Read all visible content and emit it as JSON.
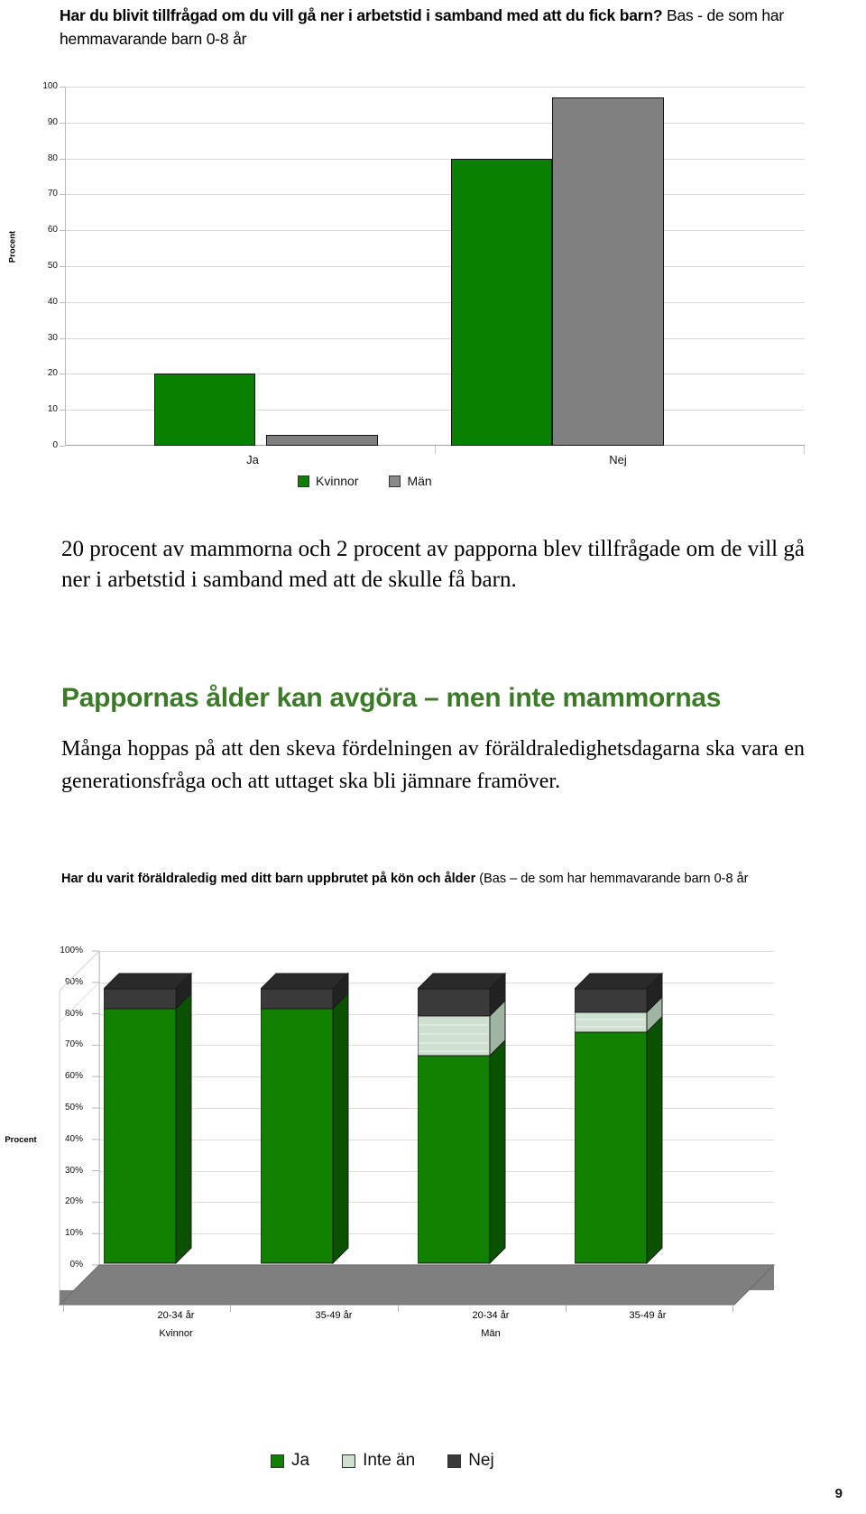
{
  "page_number": "9",
  "chart1": {
    "title_bold": "Har du blivit tillfrågad om du vill gå ner i arbetstid i samband med att du fick barn?",
    "title_light": "Bas - de som har hemmavarande barn 0-8 år",
    "axis_title": "Procent",
    "legend": [
      {
        "label": "Kvinnor",
        "color": "#0a8000"
      },
      {
        "label": "Män",
        "color": "#8a8a8a"
      }
    ],
    "categories": [
      "Ja",
      "Nej"
    ],
    "yticks": [
      "100",
      "90",
      "80",
      "70",
      "60",
      "50",
      "40",
      "30",
      "20",
      "10",
      "0"
    ]
  },
  "lead_paragraph": "20 procent av mammorna och 2 procent av papporna blev tillfrågade om de vill gå ner i arbetstid i samband med att de skulle få barn.",
  "green_heading": "Pappornas ålder kan avgöra – men inte mammornas",
  "paragraph_2": "Många hoppas på att den skeva fördelningen av föräldraledighetsdagarna ska vara en generationsfråga och att uttaget ska bli jämnare framöver.",
  "chart2": {
    "title_bold": "Har du varit föräldraledig med ditt barn uppbrutet på kön och ålder",
    "title_light": "(Bas – de som har hemmavarande barn 0-8 år",
    "axis_title": "Procent",
    "yticks": [
      "100%",
      "90%",
      "80%",
      "70%",
      "60%",
      "50%",
      "40%",
      "30%",
      "20%",
      "10%",
      "0%"
    ],
    "legend": [
      {
        "label": "Ja",
        "color": "#118000"
      },
      {
        "label": "Inte än",
        "color": "#cfe0d0"
      },
      {
        "label": "Nej",
        "color": "#3a3a3a"
      }
    ]
  },
  "chart_data": [
    {
      "type": "bar",
      "title": "Har du blivit tillfrågad om du vill gå ner i arbetstid i samband med att du fick barn? Bas - de som har hemmavarande barn 0-8 år",
      "xlabel": "",
      "ylabel": "Procent",
      "ylim": [
        0,
        100
      ],
      "yticks": [
        0,
        10,
        20,
        30,
        40,
        50,
        60,
        70,
        80,
        90,
        100
      ],
      "grid": true,
      "legend_position": "bottom",
      "categories": [
        "Ja",
        "Nej"
      ],
      "series": [
        {
          "name": "Kvinnor",
          "color": "#0a8000",
          "values": [
            20,
            80
          ]
        },
        {
          "name": "Män",
          "color": "#808080",
          "values": [
            2,
            97
          ]
        }
      ]
    },
    {
      "type": "bar",
      "subtype": "stacked-3d",
      "title": "Har du varit föräldraledig med ditt barn uppbrutet på kön och ålder (Bas – de som har hemmavarande barn 0-8 år",
      "xlabel": "",
      "ylabel": "Procent",
      "ylim": [
        0,
        100
      ],
      "yticks": [
        0,
        10,
        20,
        30,
        40,
        50,
        60,
        70,
        80,
        90,
        100
      ],
      "grid": true,
      "legend_position": "bottom",
      "categories": [
        "20-34 år",
        "35-49 år",
        "20-34 år",
        "35-49 år"
      ],
      "groups": [
        "Kvinnor",
        "Kvinnor",
        "Män",
        "Män"
      ],
      "series": [
        {
          "name": "Ja",
          "color": "#118000",
          "values": [
            97,
            97,
            80,
            89
          ]
        },
        {
          "name": "Inte än",
          "color": "#cfe0d0",
          "values": [
            0,
            0,
            12,
            6
          ]
        },
        {
          "name": "Nej",
          "color": "#3a3a3a",
          "values": [
            3,
            3,
            8,
            5
          ]
        }
      ]
    }
  ]
}
